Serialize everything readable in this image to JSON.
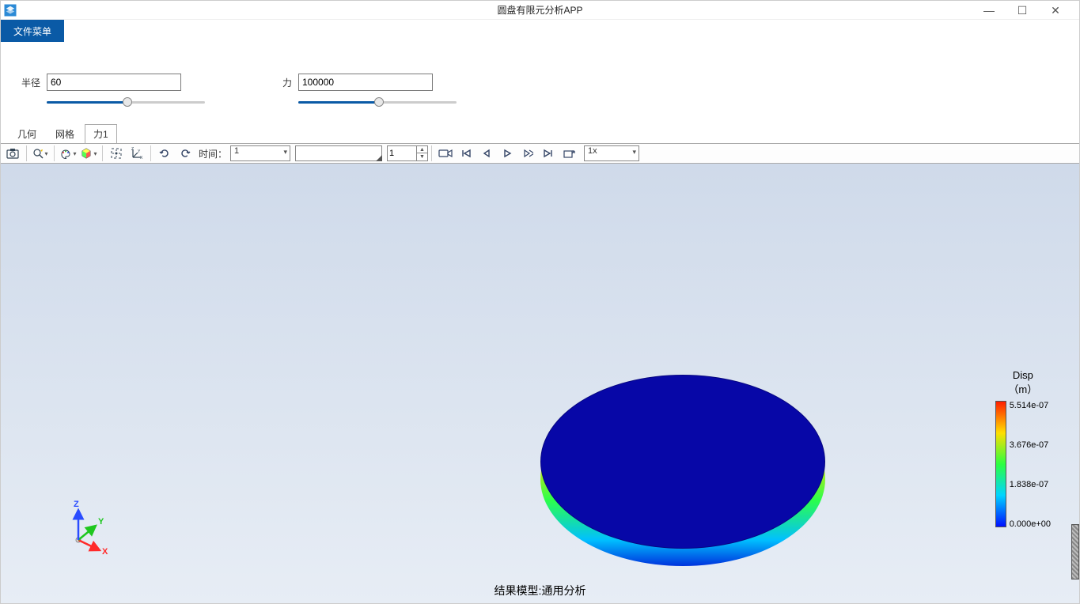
{
  "window": {
    "title": "圆盘有限元分析APP"
  },
  "menu": {
    "file": "文件菜单"
  },
  "params": {
    "radius_label": "半径",
    "radius_value": "60",
    "force_label": "力",
    "force_value": "100000"
  },
  "tabs": {
    "geometry": "几何",
    "mesh": "网格",
    "force1": "力1"
  },
  "toolbar": {
    "time_label": "时间：",
    "time_combo": "1",
    "time_spin": "1",
    "speed_combo": "1x"
  },
  "legend": {
    "title": "Disp",
    "unit": "（m）",
    "ticks": [
      "5.514e-07",
      "3.676e-07",
      "1.838e-07",
      "0.000e+00"
    ]
  },
  "axis": {
    "x": "X",
    "y": "Y",
    "z": "Z"
  },
  "footer": "结果模型:通用分析"
}
